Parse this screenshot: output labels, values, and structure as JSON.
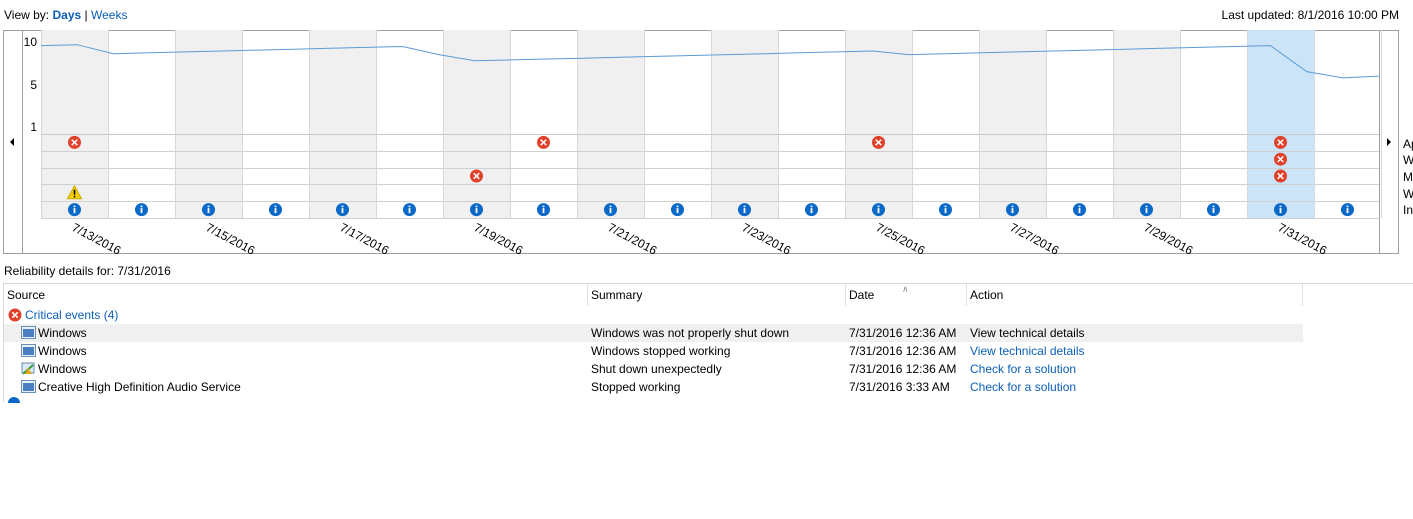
{
  "header": {
    "view_by_label": "View by:",
    "view_days": "Days",
    "separator": "|",
    "view_weeks": "Weeks",
    "last_updated": "Last updated: 8/1/2016 10:00 PM"
  },
  "chart_data": {
    "type": "line",
    "y_ticks": [
      "10",
      "5",
      "1"
    ],
    "ylim": [
      1,
      10
    ],
    "x_labels": [
      "7/13/2016",
      "7/15/2016",
      "7/17/2016",
      "7/19/2016",
      "7/21/2016",
      "7/23/2016",
      "7/25/2016",
      "7/27/2016",
      "7/29/2016",
      "7/31/2016"
    ],
    "row_labels": [
      "Ap",
      "W",
      "M",
      "W",
      "In"
    ],
    "selected_day": "7/31/2016",
    "colors": {
      "line": "#5b9bd5",
      "selected": "#cce4f7",
      "shade": "#f0f0f0",
      "critical": "#e0412b",
      "warning": "#f5d000",
      "info": "#0a68c9"
    },
    "stability_index": [
      9.6,
      9.7,
      8.7,
      8.8,
      8.9,
      9.0,
      9.1,
      9.2,
      9.3,
      9.4,
      9.5,
      8.6,
      7.9,
      8.0,
      8.1,
      8.2,
      8.3,
      8.4,
      8.5,
      8.6,
      8.7,
      8.8,
      8.9,
      9.0,
      8.6,
      8.7,
      8.8,
      8.9,
      9.0,
      9.1,
      9.2,
      9.3,
      9.4,
      9.5,
      9.6,
      6.7,
      6.0,
      6.2
    ],
    "events": {
      "critical_row0": [
        0,
        7,
        12,
        18
      ],
      "critical_row1": [
        18
      ],
      "critical_row2": [
        6,
        18
      ],
      "warning_row3": [
        0
      ],
      "info_row4": [
        0,
        1,
        2,
        3,
        4,
        5,
        6,
        7,
        8,
        9,
        10,
        11,
        12,
        13,
        14,
        15,
        16,
        17,
        18,
        19
      ]
    }
  },
  "details": {
    "title": "Reliability details for: 7/31/2016",
    "columns": {
      "source": "Source",
      "summary": "Summary",
      "date": "Date",
      "action": "Action"
    },
    "group_label": "Critical events (4)",
    "rows": [
      {
        "source": "Windows",
        "summary": "Windows was not properly shut down",
        "date": "7/31/2016 12:36 AM",
        "action": "View  technical details",
        "icon": "window-icon"
      },
      {
        "source": "Windows",
        "summary": "Windows stopped working",
        "date": "7/31/2016 12:36 AM",
        "action": "View  technical details",
        "icon": "window-icon"
      },
      {
        "source": "Windows",
        "summary": "Shut down unexpectedly",
        "date": "7/31/2016 12:36 AM",
        "action": "Check for a solution",
        "icon": "shutdown-icon"
      },
      {
        "source": "Creative High Definition Audio Service",
        "summary": "Stopped working",
        "date": "7/31/2016 3:33 AM",
        "action": "Check for a solution",
        "icon": "window-icon"
      }
    ]
  }
}
